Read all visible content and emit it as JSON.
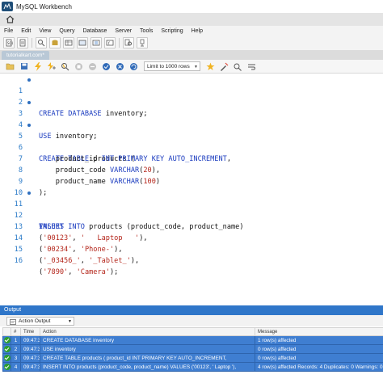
{
  "window": {
    "title": "MySQL Workbench"
  },
  "menu": [
    "File",
    "Edit",
    "View",
    "Query",
    "Database",
    "Server",
    "Tools",
    "Scripting",
    "Help"
  ],
  "connection_tab": "tutorialkart.com*",
  "limit_select": "Limit to 1000 rows",
  "editor": {
    "line_numbers": [
      "1",
      "2",
      "3",
      "4",
      "5",
      "6",
      "7",
      "8",
      "9",
      "10",
      "11",
      "12",
      "13",
      "14",
      "15",
      "16"
    ],
    "lines": [
      "CREATE DATABASE inventory;",
      "",
      "USE inventory;",
      "",
      "CREATE TABLE products (",
      "    product_id INT PRIMARY KEY AUTO_INCREMENT,",
      "    product_code VARCHAR(20),",
      "    product_name VARCHAR(100)",
      ");",
      "",
      "INSERT INTO products (product_code, product_name)",
      "VALUES",
      "('00123', '   Laptop   '),",
      "('00234', 'Phone-'),",
      "('_03456_', '_Tablet_'),",
      "('7890', 'Camera');"
    ]
  },
  "output": {
    "header": "Output",
    "mode": "Action Output",
    "columns": [
      "#",
      "Time",
      "Action",
      "Message"
    ],
    "rows": [
      {
        "num": "1",
        "time": "09:47:34",
        "action": "CREATE DATABASE inventory",
        "message": "1 row(s) affected"
      },
      {
        "num": "2",
        "time": "09:47:34",
        "action": "USE inventory",
        "message": "0 row(s) affected"
      },
      {
        "num": "3",
        "time": "09:47:34",
        "action": "CREATE TABLE products (     product_id INT PRIMARY KEY AUTO_INCREMENT,",
        "message": "0 row(s) affected"
      },
      {
        "num": "4",
        "time": "09:47:34",
        "action": "INSERT INTO products (product_code, product_name) VALUES ('00123', '   Laptop   '),",
        "message": "4 row(s) affected Records: 4  Duplicates: 0  Warnings: 0"
      }
    ]
  },
  "colors": {
    "accent": "#2f76c9",
    "keyword": "#1a3bbf",
    "literal": "#b4251a",
    "line_number": "#2b7bc8"
  }
}
